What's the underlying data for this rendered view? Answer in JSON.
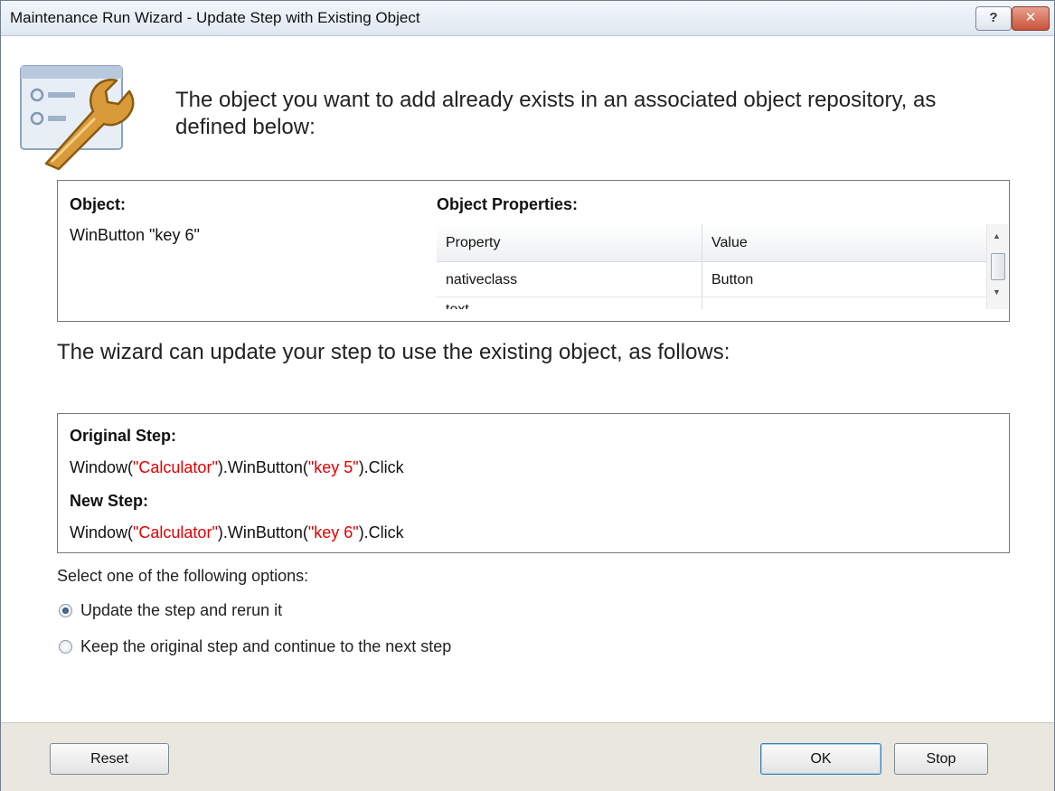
{
  "window": {
    "title": "Maintenance Run Wizard - Update Step with Existing Object",
    "help_label": "?",
    "close_label": "✕"
  },
  "header": {
    "text": "The object you want to add already exists in an associated object repository, as defined below:"
  },
  "object_panel": {
    "object_label": "Object:",
    "object_value": "WinButton \"key 6\"",
    "properties_label": "Object Properties:",
    "columns": [
      "Property",
      "Value"
    ],
    "rows": [
      {
        "property": "nativeclass",
        "value": "Button"
      },
      {
        "property": "text",
        "value": ""
      }
    ]
  },
  "wizard_text": "The wizard can update your step to use the existing object, as follows:",
  "steps": {
    "original_label": "Original Step:",
    "original": {
      "prefix": "Window(",
      "window_arg": "\"Calculator\"",
      "mid": ").WinButton(",
      "button_arg": "\"key 5\"",
      "suffix": ").Click"
    },
    "new_label": "New Step:",
    "new": {
      "prefix": "Window(",
      "window_arg": "\"Calculator\"",
      "mid": ").WinButton(",
      "button_arg": "\"key 6\"",
      "suffix": ").Click"
    }
  },
  "options": {
    "prompt": "Select one of the following options:",
    "items": [
      {
        "label": "Update the step and rerun it",
        "selected": true
      },
      {
        "label": "Keep the original step and continue to the next step",
        "selected": false
      }
    ]
  },
  "buttons": {
    "reset": "Reset",
    "ok": "OK",
    "stop": "Stop"
  },
  "colors": {
    "string_literal": "#e20000"
  }
}
